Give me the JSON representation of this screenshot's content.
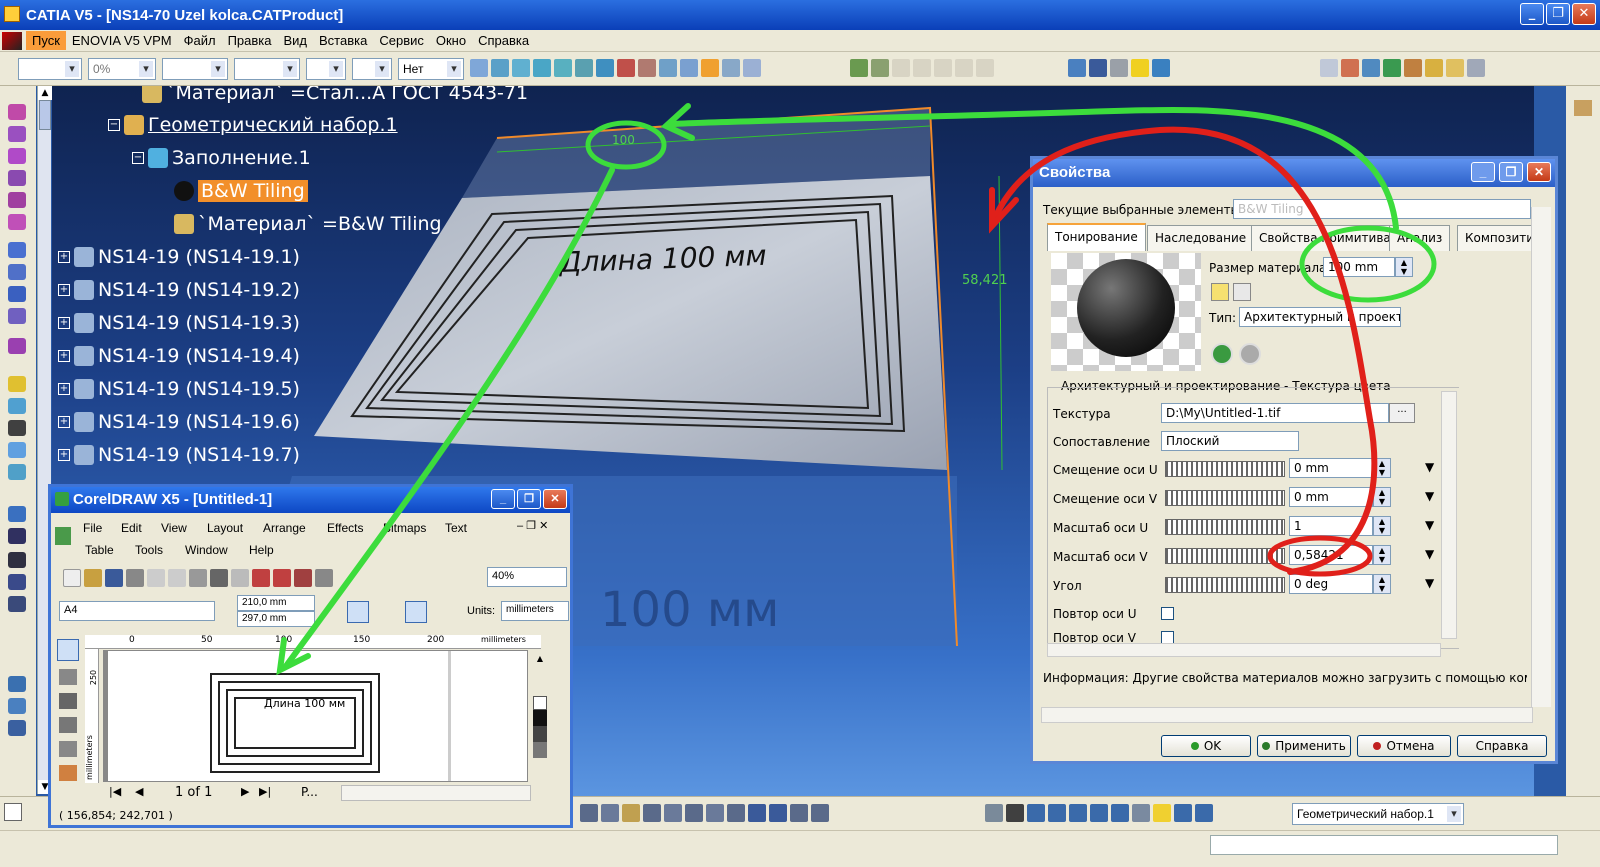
{
  "window": {
    "title": "CATIA V5 - [NS14-70 Uzel kolca.CATProduct]"
  },
  "menu": [
    "Пуск",
    "ENOVIA V5 VPM",
    "Файл",
    "Правка",
    "Вид",
    "Вставка",
    "Сервис",
    "Окно",
    "Справка"
  ],
  "toolbar": {
    "percent": "0%",
    "net": "Нет"
  },
  "tree": {
    "material_steel": "`Материал` =Стал...А ГОСТ 4543-71",
    "geom_set": "Геометрический набор.1",
    "fill": "Заполнение.1",
    "bw_tiling": "B&W Tiling",
    "material_bw": "`Материал` =B&W Tiling",
    "parts": [
      "NS14-19 (NS14-19.1)",
      "NS14-19 (NS14-19.2)",
      "NS14-19 (NS14-19.3)",
      "NS14-19 (NS14-19.4)",
      "NS14-19 (NS14-19.5)",
      "NS14-19 (NS14-19.6)",
      "NS14-19 (NS14-19.7)"
    ]
  },
  "viewport": {
    "plate_text": "Длина 100 мм",
    "reflection_text": "100 мм",
    "dim_top": "100",
    "dim_right": "58,421"
  },
  "bottom": {
    "geom_set_combo": "Геометрический набор.1"
  },
  "properties": {
    "title": "Свойства",
    "current_label": "Текущие выбранные элементы:",
    "current_value": "B&W Tiling",
    "tabs": [
      "Тонирование",
      "Наследование",
      "Свойства примитива",
      "Анализ",
      "Композити"
    ],
    "size_label": "Размер материала",
    "size_value": "100 mm",
    "type_label": "Тип:",
    "type_value": "Архитектурный и проект",
    "group_title": "Архитектурный и проектирование - Текстура цвета",
    "texture_label": "Текстура",
    "texture_value": "D:\\My\\Untitled-1.tif",
    "mapping_label": "Сопоставление",
    "mapping_value": "Плоский",
    "rows": [
      {
        "label": "Смещение оси U",
        "value": "0 mm"
      },
      {
        "label": "Смещение оси V",
        "value": "0 mm"
      },
      {
        "label": "Масштаб оси U",
        "value": "1"
      },
      {
        "label": "Масштаб оси V",
        "value": "0,58421"
      },
      {
        "label": "Угол",
        "value": "0 deg"
      }
    ],
    "repeat_u": "Повтор оси U",
    "repeat_v": "Повтор оси V",
    "info": "Информация: Другие свойства материалов можно загрузить с помощью команды Р",
    "ok": "OK",
    "apply": "Применить",
    "cancel": "Отмена",
    "help": "Справка"
  },
  "corel": {
    "title": "CorelDRAW X5 - [Untitled-1]",
    "menu1": [
      "File",
      "Edit",
      "View",
      "Layout",
      "Arrange",
      "Effects",
      "Bitmaps",
      "Text"
    ],
    "menu2": [
      "Table",
      "Tools",
      "Window",
      "Help"
    ],
    "zoom": "40%",
    "paper": "A4",
    "width": "210,0 mm",
    "height": "297,0 mm",
    "units_label": "Units:",
    "units_value": "millimeters",
    "ruler_labels": [
      "0",
      "50",
      "100",
      "150",
      "200"
    ],
    "ruler_units": "millimeters",
    "ruler_v_label": "250",
    "ruler_v_units": "millimeters",
    "canvas_text": "Длина 100 мм",
    "page_nav": "1 of 1",
    "page_tab": "P...",
    "coords": "( 156,854; 242,701 )"
  },
  "colors": {
    "catia_title": "#0a3fb8",
    "selection": "#f28f2a",
    "annotation_green": "#3cdc3c",
    "annotation_red": "#e0201a"
  }
}
